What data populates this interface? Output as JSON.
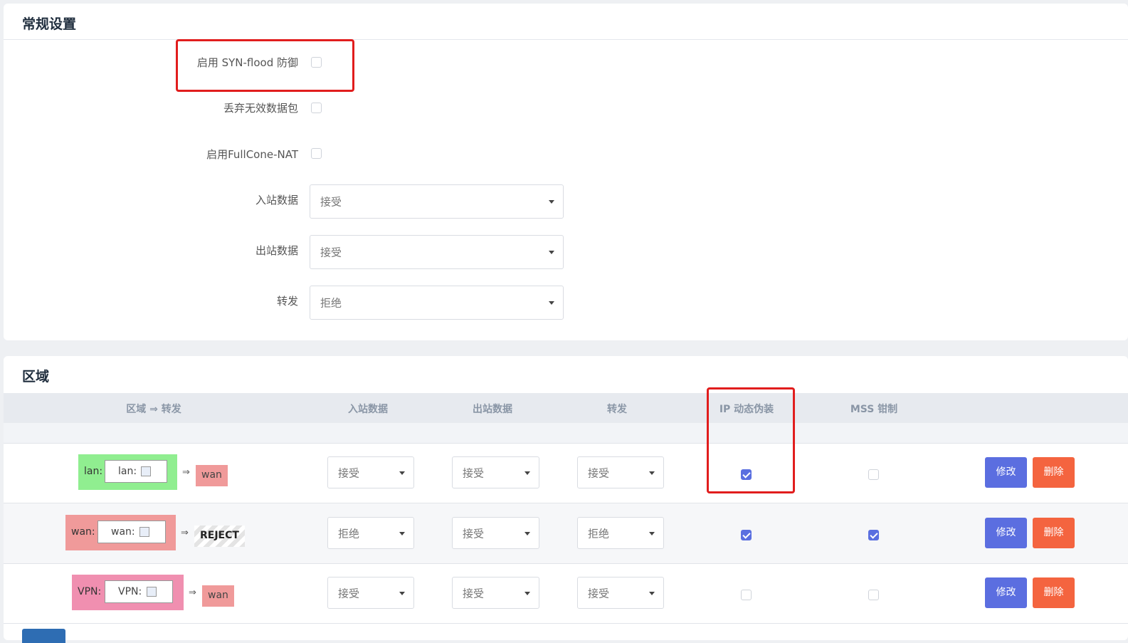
{
  "general": {
    "title": "常规设置",
    "syn_flood_label": "启用 SYN-flood 防御",
    "drop_invalid_label": "丢弃无效数据包",
    "fullcone_label": "启用FullCone-NAT",
    "input_label": "入站数据",
    "input_value": "接受",
    "output_label": "出站数据",
    "output_value": "接受",
    "forward_label": "转发",
    "forward_value": "拒绝",
    "syn_flood_checked": false,
    "drop_invalid_checked": false,
    "fullcone_checked": false
  },
  "zones": {
    "title": "区域",
    "columns": [
      "区域 ⇒ 转发",
      "入站数据",
      "出站数据",
      "转发",
      "IP 动态伪装",
      "MSS 钳制"
    ],
    "rows": [
      {
        "zone": "lan:",
        "inner": "lan:",
        "arrow": "⇒",
        "dest": "wan",
        "zone_color": "#90ee90",
        "input": "接受",
        "output": "接受",
        "forward": "接受",
        "masq": true,
        "mss": false,
        "edit": "修改",
        "delete": "删除"
      },
      {
        "zone": "wan:",
        "inner": "wan:",
        "arrow": "⇒",
        "dest": "REJECT",
        "zone_color": "#f09a9a",
        "input": "拒绝",
        "output": "接受",
        "forward": "拒绝",
        "masq": true,
        "mss": true,
        "edit": "修改",
        "delete": "删除"
      },
      {
        "zone": "VPN:",
        "inner": "VPN:",
        "arrow": "⇒",
        "dest": "wan",
        "zone_color": "#f08fb0",
        "input": "接受",
        "output": "接受",
        "forward": "接受",
        "masq": false,
        "mss": false,
        "edit": "修改",
        "delete": "删除"
      }
    ]
  },
  "colors": {
    "accent": "#5b6ee0",
    "danger": "#f4643f",
    "highlight": "#e11d1d"
  }
}
